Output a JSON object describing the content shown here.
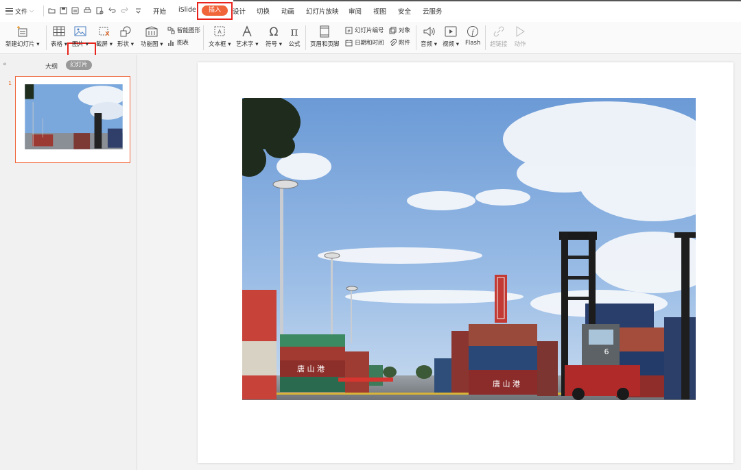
{
  "menubar": {
    "file_label": "文件",
    "tabs": [
      "开始",
      "iSlide",
      "插入",
      "设计",
      "切换",
      "动画",
      "幻灯片放映",
      "审阅",
      "视图",
      "安全",
      "云服务"
    ],
    "active_tab_index": 2
  },
  "ribbon": {
    "new_slide": "新建幻灯片",
    "table": "表格",
    "picture": "图片",
    "screenshot": "截屏",
    "shapes": "形状",
    "function_chart": "功能图",
    "smart_art": "智能图形",
    "chart": "图表",
    "textbox": "文本框",
    "wordart": "艺术字",
    "symbol": "符号",
    "formula": "公式",
    "header_footer": "页眉和页脚",
    "slide_number": "幻灯片编号",
    "date_time": "日期和时间",
    "object": "对象",
    "attachment": "附件",
    "audio": "音频",
    "video": "视频",
    "flash": "Flash",
    "hyperlink": "超链接",
    "action": "动作"
  },
  "left_panel": {
    "collapse_glyph": "«",
    "outline_label": "大纲",
    "slides_label": "幻灯片",
    "slide_number": "1"
  },
  "photo_content": {
    "port_sign": "唐 山 港",
    "crane_number": "6"
  },
  "colors": {
    "accent": "#f0653a",
    "highlight_red": "#e8231b"
  }
}
